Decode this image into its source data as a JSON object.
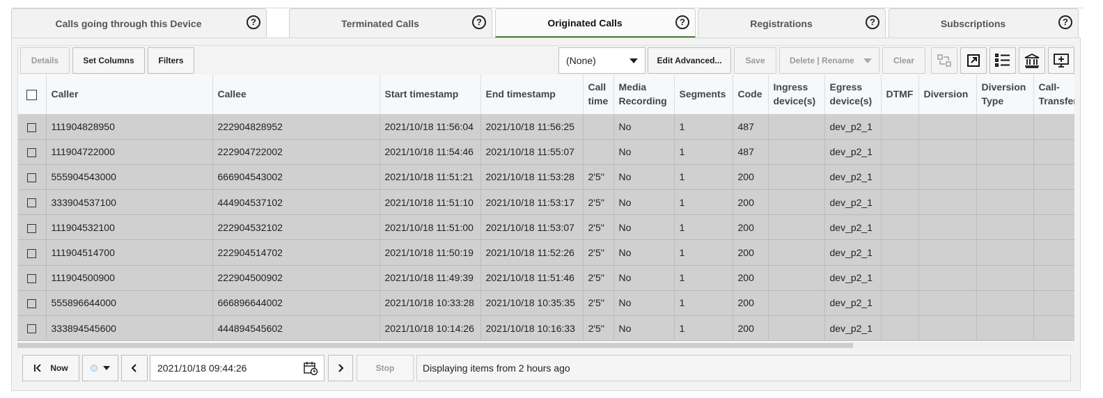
{
  "tabs": [
    {
      "label": "Calls going through this Device",
      "active": false
    },
    {
      "label": "Terminated Calls",
      "active": false
    },
    {
      "label": "Originated Calls",
      "active": true
    },
    {
      "label": "Registrations",
      "active": false
    },
    {
      "label": "Subscriptions",
      "active": false
    }
  ],
  "help_glyph": "?",
  "toolbar": {
    "details": "Details",
    "set_columns": "Set Columns",
    "filters": "Filters",
    "filter_select": "(None)",
    "edit_advanced": "Edit Advanced...",
    "save": "Save",
    "delete_rename": "Delete | Rename",
    "clear": "Clear"
  },
  "table": {
    "columns": [
      "Caller",
      "Callee",
      "Start timestamp",
      "End timestamp",
      "Call time",
      "Media Recording",
      "Segments",
      "Code",
      "Ingress device(s)",
      "Egress device(s)",
      "DTMF",
      "Diversion",
      "Diversion Type",
      "Call-Transfer"
    ],
    "rows": [
      [
        "111904828950",
        "222904828952",
        "2021/10/18 11:56:04",
        "2021/10/18 11:56:25",
        "",
        "No",
        "1",
        "487",
        "",
        "dev_p2_1",
        "",
        "",
        "",
        ""
      ],
      [
        "111904722000",
        "222904722002",
        "2021/10/18 11:54:46",
        "2021/10/18 11:55:07",
        "",
        "No",
        "1",
        "487",
        "",
        "dev_p2_1",
        "",
        "",
        "",
        ""
      ],
      [
        "555904543000",
        "666904543002",
        "2021/10/18 11:51:21",
        "2021/10/18 11:53:28",
        "2'5''",
        "No",
        "1",
        "200",
        "",
        "dev_p2_1",
        "",
        "",
        "",
        ""
      ],
      [
        "333904537100",
        "444904537102",
        "2021/10/18 11:51:10",
        "2021/10/18 11:53:17",
        "2'5''",
        "No",
        "1",
        "200",
        "",
        "dev_p2_1",
        "",
        "",
        "",
        ""
      ],
      [
        "111904532100",
        "222904532102",
        "2021/10/18 11:51:00",
        "2021/10/18 11:53:07",
        "2'5''",
        "No",
        "1",
        "200",
        "",
        "dev_p2_1",
        "",
        "",
        "",
        ""
      ],
      [
        "111904514700",
        "222904514702",
        "2021/10/18 11:50:19",
        "2021/10/18 11:52:26",
        "2'5''",
        "No",
        "1",
        "200",
        "",
        "dev_p2_1",
        "",
        "",
        "",
        ""
      ],
      [
        "111904500900",
        "222904500902",
        "2021/10/18 11:49:39",
        "2021/10/18 11:51:46",
        "2'5''",
        "No",
        "1",
        "200",
        "",
        "dev_p2_1",
        "",
        "",
        "",
        ""
      ],
      [
        "555896644000",
        "666896644002",
        "2021/10/18 10:33:28",
        "2021/10/18 10:35:35",
        "2'5''",
        "No",
        "1",
        "200",
        "",
        "dev_p2_1",
        "",
        "",
        "",
        ""
      ],
      [
        "333894545600",
        "444894545602",
        "2021/10/18 10:14:26",
        "2021/10/18 10:16:33",
        "2'5''",
        "No",
        "1",
        "200",
        "",
        "dev_p2_1",
        "",
        "",
        "",
        ""
      ]
    ]
  },
  "footer": {
    "now": "Now",
    "date_value": "2021/10/18 09:44:26",
    "stop": "Stop",
    "status_text": "Displaying items from 2 hours ago"
  },
  "colors": {
    "active_tab_underline": "#4a7a3a",
    "row_background": "#d0d0d0",
    "header_background": "#f5f9fc"
  }
}
